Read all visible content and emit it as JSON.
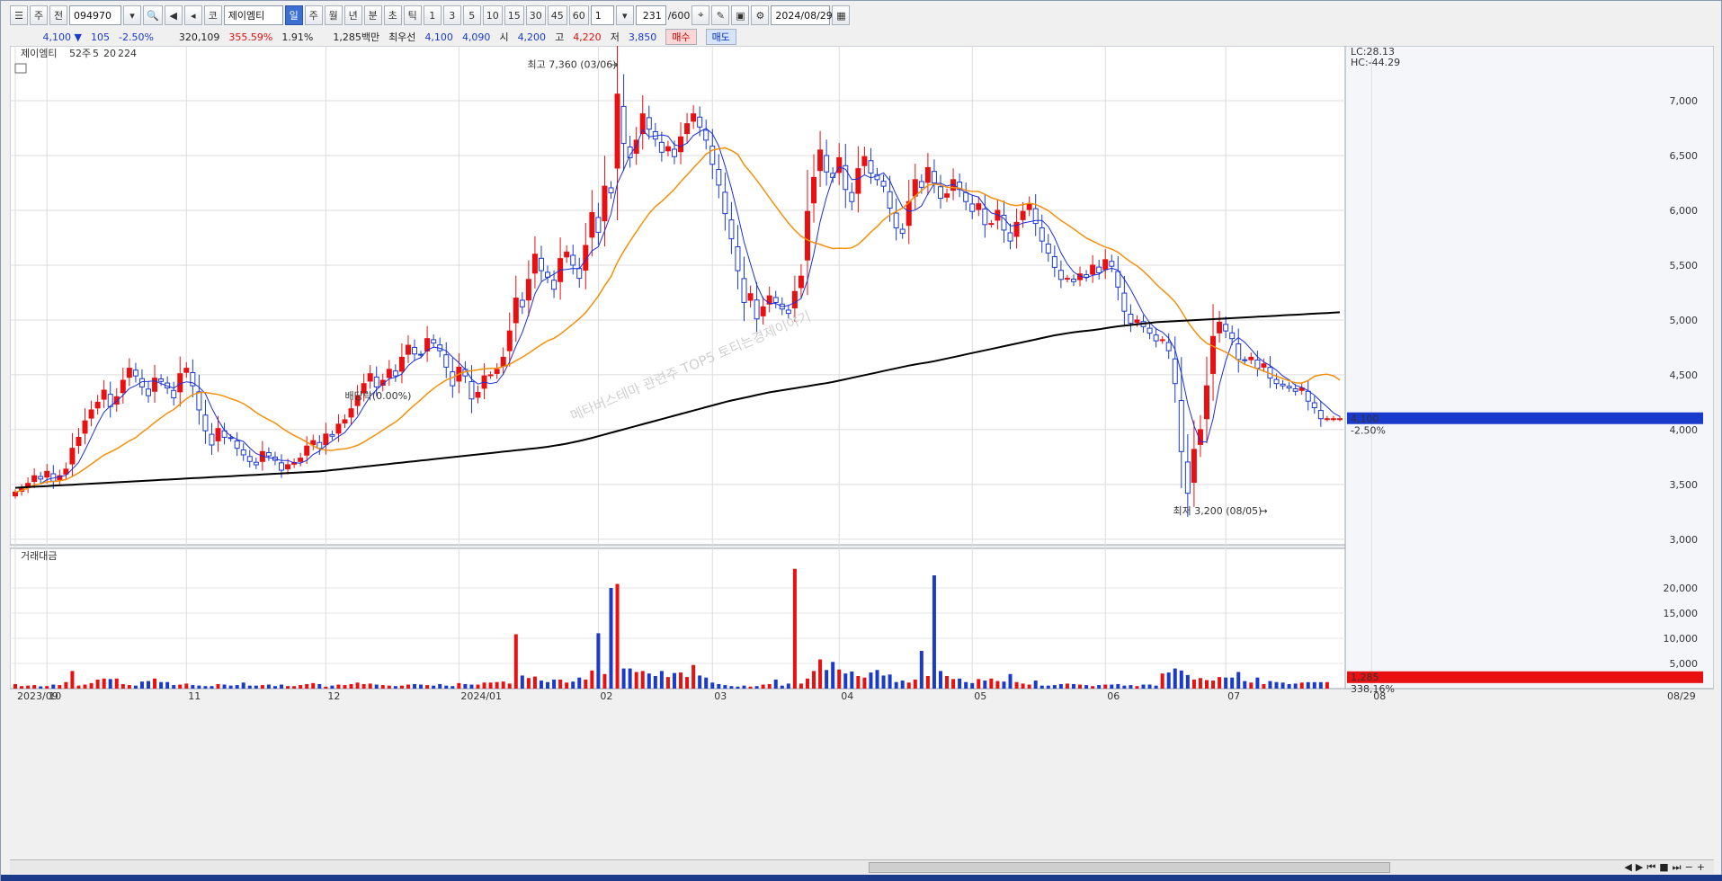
{
  "toolbar": {
    "code": "094970",
    "name": "제이엠티",
    "period_day": "일",
    "period_week": "주",
    "period_month": "월",
    "period_year": "년",
    "period_min": "분",
    "period_sec": "초",
    "period_tick": "틱",
    "intervals": [
      "1",
      "3",
      "5",
      "10",
      "15",
      "30",
      "45",
      "60"
    ],
    "multiplier": "1",
    "count": "231",
    "count_max": "/600",
    "date": "2024/08/29",
    "label_ju": "주",
    "label_jeon": "전",
    "label_ko": "코"
  },
  "info": {
    "price": "4,100",
    "change": "105",
    "change_pct": "-2.50%",
    "volume": "320,109",
    "vol_ratio": "355.59%",
    "turnover": "1.91%",
    "amount": "1,285백만",
    "priority_label": "최우선",
    "best_ask": "4,100",
    "best_bid": "4,090",
    "open_label": "시",
    "open": "4,200",
    "high_label": "고",
    "high": "4,220",
    "low_label": "저",
    "low": "3,850",
    "buy": "매수",
    "sell": "매도"
  },
  "colors": {
    "up": "#e81010",
    "down": "#1a3acc",
    "ma5": "#1a2ee0",
    "ma20": "#f5900a",
    "ma224": "#000000"
  },
  "chart_data": [
    {
      "type": "candlestick",
      "title": "제이엠티",
      "legend": {
        "prefix": "52주",
        "ma_fast": "5",
        "ma_mid": "20",
        "ma_slow": "224"
      },
      "ylim": [
        2950,
        7500
      ],
      "yticks": [
        3000,
        3500,
        4000,
        4500,
        5000,
        5500,
        6000,
        6500,
        7000
      ],
      "xticks": [
        {
          "i": 0,
          "label": "2023/09"
        },
        {
          "i": 5,
          "label": "10"
        },
        {
          "i": 27,
          "label": "11"
        },
        {
          "i": 49,
          "label": "12"
        },
        {
          "i": 70,
          "label": "2024/01"
        },
        {
          "i": 92,
          "label": "02"
        },
        {
          "i": 110,
          "label": "03"
        },
        {
          "i": 130,
          "label": "04"
        },
        {
          "i": 151,
          "label": "05"
        },
        {
          "i": 172,
          "label": "06"
        },
        {
          "i": 191,
          "label": "07"
        },
        {
          "i": 214,
          "label": "08"
        }
      ],
      "last_date_label": "08/29",
      "price_badge": "4,100",
      "pct_badge": "-2.50%",
      "lc_label": "LC:28.13",
      "hc_label": "HC:-44.29",
      "annotations": {
        "high": "최고 7,360 (03/06)",
        "low": "최저 3,200 (08/05)",
        "dividend": "배당락(0.00%)",
        "watermark": "메타버스테마 관련주 TOP5 토티는경제이야기"
      },
      "close": [
        3430,
        3460,
        3510,
        3580,
        3550,
        3620,
        3530,
        3580,
        3640,
        3830,
        3930,
        4080,
        4180,
        4250,
        4360,
        4210,
        4300,
        4450,
        4560,
        4490,
        4390,
        4310,
        4470,
        4440,
        4380,
        4290,
        4510,
        4560,
        4400,
        4180,
        3990,
        3860,
        4010,
        3930,
        3920,
        3830,
        3770,
        3710,
        3680,
        3800,
        3760,
        3720,
        3630,
        3680,
        3700,
        3740,
        3850,
        3900,
        3830,
        3960,
        3940,
        4050,
        4090,
        4190,
        4310,
        4420,
        4510,
        4390,
        4450,
        4550,
        4490,
        4660,
        4770,
        4690,
        4680,
        4830,
        4790,
        4720,
        4570,
        4400,
        4570,
        4490,
        4280,
        4340,
        4490,
        4500,
        4550,
        4660,
        4900,
        5200,
        5120,
        5370,
        5600,
        5450,
        5390,
        5280,
        5560,
        5620,
        5500,
        5380,
        5680,
        5980,
        5800,
        6220,
        6160,
        7060,
        6610,
        6480,
        6640,
        6880,
        6740,
        6650,
        6530,
        6580,
        6490,
        6670,
        6790,
        6880,
        6760,
        6640,
        6420,
        6230,
        5970,
        5740,
        5450,
        5160,
        5240,
        5010,
        5120,
        5220,
        5160,
        5100,
        5060,
        5260,
        5400,
        5990,
        6300,
        6550,
        6350,
        6300,
        6480,
        6190,
        6080,
        6380,
        6490,
        6340,
        6280,
        6220,
        6020,
        5840,
        5790,
        6080,
        6280,
        6210,
        6390,
        6250,
        6110,
        6150,
        6280,
        6190,
        6080,
        5990,
        6060,
        5870,
        5880,
        6000,
        5820,
        5720,
        5890,
        5990,
        6060,
        5880,
        5720,
        5610,
        5480,
        5370,
        5380,
        5350,
        5420,
        5390,
        5500,
        5430,
        5550,
        5490,
        5300,
        5080,
        4970,
        5000,
        4940,
        4880,
        4810,
        4820,
        4720,
        4420,
        3800,
        3420,
        3820,
        4000,
        4400,
        4850,
        4980,
        4900,
        4830,
        4640,
        4630,
        4660,
        4560,
        4600,
        4470,
        4420,
        4400,
        4380,
        4350,
        4380,
        4260,
        4200,
        4100,
        4100,
        4100,
        4100
      ],
      "volume": [
        900,
        500,
        600,
        700,
        450,
        500,
        800,
        700,
        1300,
        3500,
        600,
        800,
        1100,
        1800,
        2000,
        1900,
        2000,
        900,
        700,
        600,
        1400,
        1500,
        2000,
        1300,
        1300,
        700,
        800,
        1000,
        700,
        600,
        500,
        500,
        900,
        800,
        600,
        700,
        1200,
        600,
        600,
        700,
        800,
        500,
        800,
        500,
        500,
        700,
        900,
        1100,
        900,
        400,
        600,
        800,
        700,
        900,
        1200,
        900,
        1000,
        800,
        700,
        600,
        500,
        600,
        800,
        900,
        800,
        700,
        600,
        900,
        600,
        500,
        1100,
        900,
        800,
        800,
        1200,
        1200,
        1300,
        1400,
        1000,
        10800,
        2600,
        2100,
        2400,
        1600,
        1300,
        1800,
        1800,
        1200,
        1400,
        2200,
        1800,
        3600,
        11000,
        2900,
        20000,
        20800,
        4000,
        4000,
        3300,
        3500,
        3000,
        2500,
        3500,
        2300,
        3100,
        3200,
        2300,
        4700,
        2600,
        2200,
        1200,
        900,
        700,
        500,
        400,
        600,
        400,
        500,
        800,
        900,
        1800,
        600,
        1000,
        23800,
        1000,
        2000,
        3500,
        5800,
        3700,
        5300,
        3800,
        3000,
        3400,
        2500,
        2200,
        3200,
        3700,
        2600,
        2800,
        1300,
        1600,
        1200,
        1800,
        7500,
        2500,
        22500,
        3500,
        2500,
        1900,
        2000,
        1300,
        1100,
        1900,
        1600,
        2000,
        1500,
        1400,
        2900,
        1300,
        1000,
        800,
        1600,
        600,
        600,
        700,
        900,
        1000,
        900,
        800,
        700,
        500,
        700,
        800,
        800,
        900,
        600,
        700,
        500,
        800,
        800,
        600,
        3000,
        3200,
        4000,
        3600,
        2700,
        1800,
        2100,
        1700,
        1600,
        2300,
        2200,
        2200,
        3300,
        1500,
        1200,
        2200,
        900,
        1500,
        1300,
        1200,
        900,
        1000,
        1200,
        1285,
        1285,
        1285,
        1285
      ],
      "ma224": [
        3470,
        3480,
        3490,
        3500,
        3510,
        3520,
        3530,
        3540,
        3550,
        3560,
        3570,
        3580,
        3590,
        3600,
        3610,
        3620,
        3640,
        3660,
        3680,
        3700,
        3720,
        3740,
        3760,
        3780,
        3800,
        3820,
        3840,
        3870,
        3910,
        3960,
        4010,
        4060,
        4110,
        4160,
        4210,
        4260,
        4300,
        4340,
        4370,
        4400,
        4430,
        4470,
        4510,
        4550,
        4590,
        4620,
        4660,
        4700,
        4740,
        4780,
        4820,
        4860,
        4890,
        4910,
        4940,
        4960,
        4980,
        4990,
        5000,
        5010,
        5020,
        5030,
        5040,
        5050,
        5060,
        5070
      ],
      "ma_volume_labels": {
        "title": "거래대금",
        "badge_amount": "1,285",
        "badge_pct": "338,16%"
      },
      "volume_yticks": [
        5000,
        10000,
        15000,
        20000
      ]
    }
  ]
}
